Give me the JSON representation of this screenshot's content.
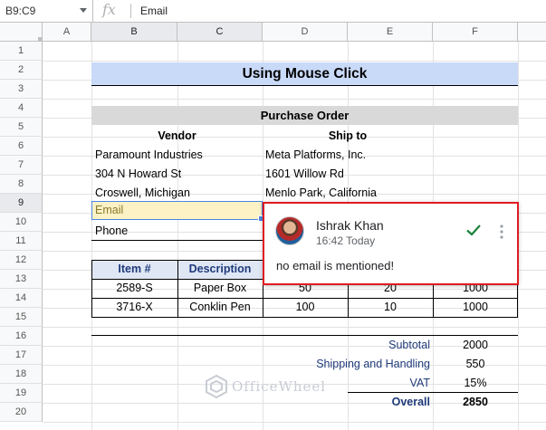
{
  "formula_bar": {
    "name_box": "B9:C9",
    "fx_label": "fx",
    "value": "Email"
  },
  "columns": [
    "A",
    "B",
    "C",
    "D",
    "E",
    "F"
  ],
  "rows": [
    "1",
    "2",
    "3",
    "4",
    "5",
    "6",
    "7",
    "8",
    "9",
    "10",
    "11",
    "12",
    "13",
    "14",
    "15",
    "16",
    "17",
    "18",
    "19",
    "20"
  ],
  "sheet": {
    "title": "Using Mouse Click",
    "section": "Purchase Order",
    "vendor_header": "Vendor",
    "shipto_header": "Ship to",
    "vendor": [
      "Paramount Industries",
      "304 N Howard St",
      "Croswell, Michigan"
    ],
    "shipto": [
      "Meta Platforms, Inc.",
      "1601 Willow Rd",
      "Menlo Park, California"
    ],
    "email_label": "Email",
    "phone_label": "Phone",
    "table_headers": [
      "Item #",
      "Description",
      "",
      "",
      ""
    ],
    "items": [
      {
        "item": "2589-S",
        "desc": "Paper Box",
        "d": "50",
        "e": "20",
        "f": "1000"
      },
      {
        "item": "3716-X",
        "desc": "Conklin Pen",
        "d": "100",
        "e": "10",
        "f": "1000"
      }
    ],
    "subtotal_label": "Subtotal",
    "subtotal": "2000",
    "shipping_label": "Shipping and Handling",
    "shipping": "550",
    "vat_label": "VAT",
    "vat": "15%",
    "overall_label": "Overall",
    "overall": "2850"
  },
  "comment": {
    "author": "Ishrak Khan",
    "time": "16:42 Today",
    "text": "no email is mentioned!",
    "highlight_color": "#e01b22"
  },
  "watermark": "OfficeWheel",
  "colors": {
    "title_fill": "#c9daf8",
    "section_fill": "#d9d9d9",
    "header_fill": "#dfe7f5",
    "selection": "#4d86e0",
    "resolve_check": "#188038"
  }
}
